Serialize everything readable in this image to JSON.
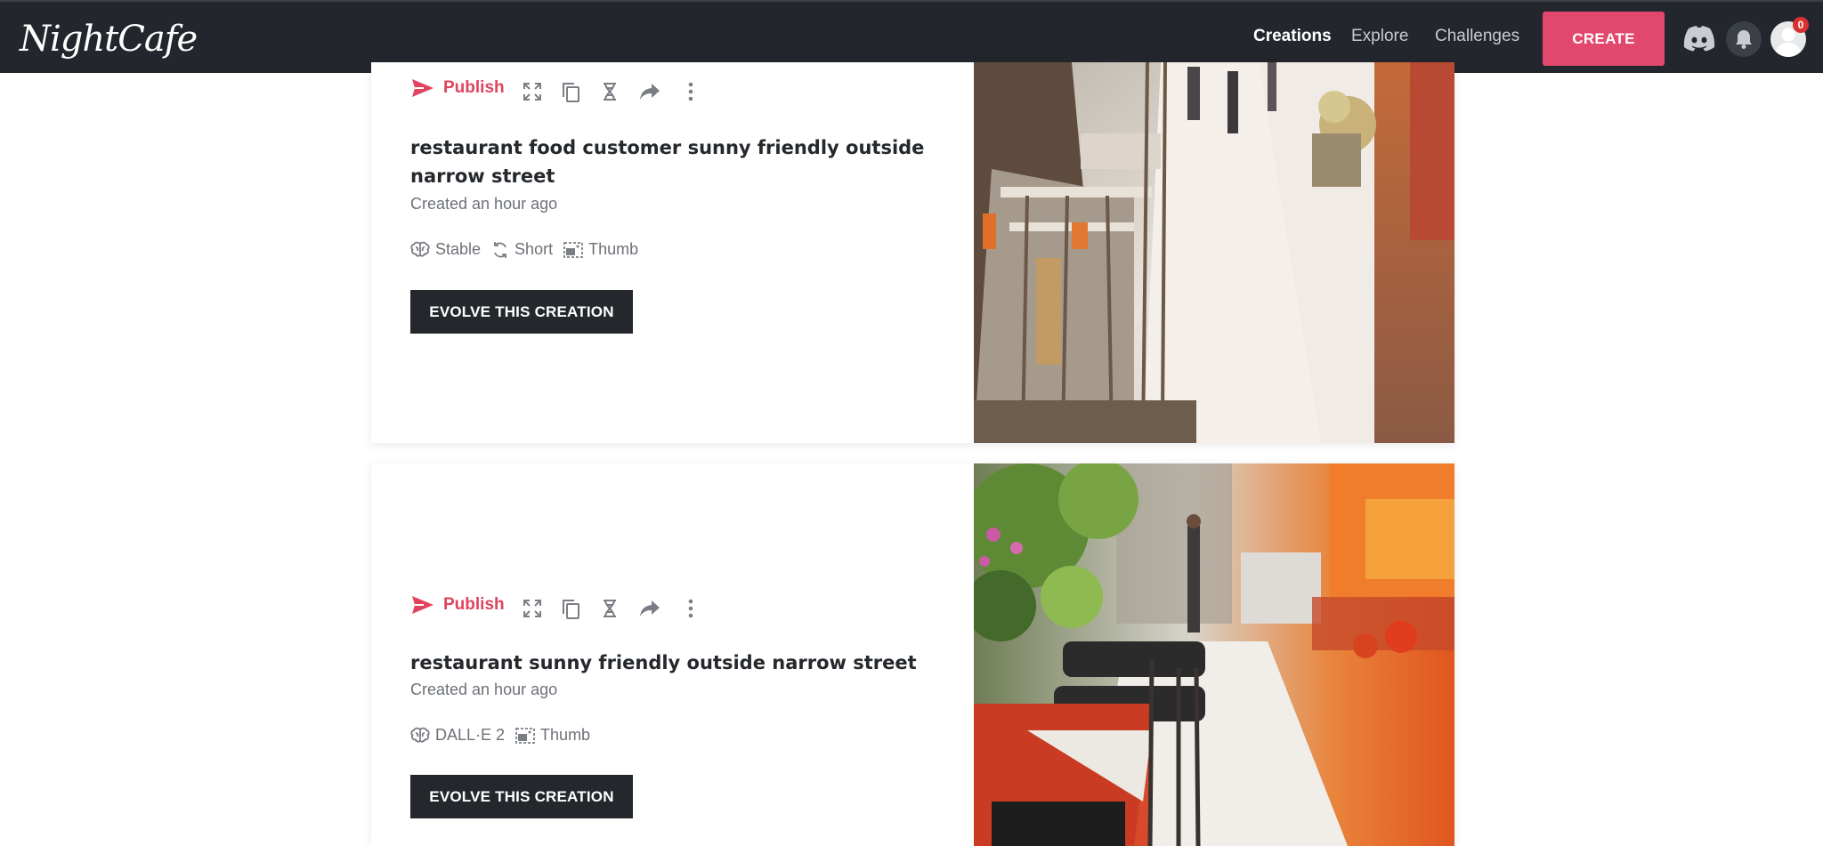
{
  "app": {
    "logo": "NightCafe"
  },
  "nav": {
    "links": [
      "Creations",
      "Explore",
      "Challenges"
    ],
    "create_label": "CREATE",
    "notification_count": "0"
  },
  "colors": {
    "accent": "#e2486d",
    "navbar": "#23272d",
    "button_dark": "#24282d"
  },
  "cards": [
    {
      "publish_label": "Publish",
      "title": "restaurant food customer sunny friendly outside narrow street",
      "created": "Created an hour ago",
      "meta": [
        {
          "icon": "brain-icon",
          "label": "Stable"
        },
        {
          "icon": "refresh-icon",
          "label": "Short"
        },
        {
          "icon": "image-icon",
          "label": "Thumb"
        }
      ],
      "evolve_label": "EVOLVE THIS CREATION"
    },
    {
      "publish_label": "Publish",
      "title": "restaurant sunny friendly outside narrow street",
      "created": "Created an hour ago",
      "meta": [
        {
          "icon": "brain-icon",
          "label": "DALL·E 2"
        },
        {
          "icon": "image-icon",
          "label": "Thumb"
        }
      ],
      "evolve_label": "EVOLVE THIS CREATION"
    }
  ]
}
